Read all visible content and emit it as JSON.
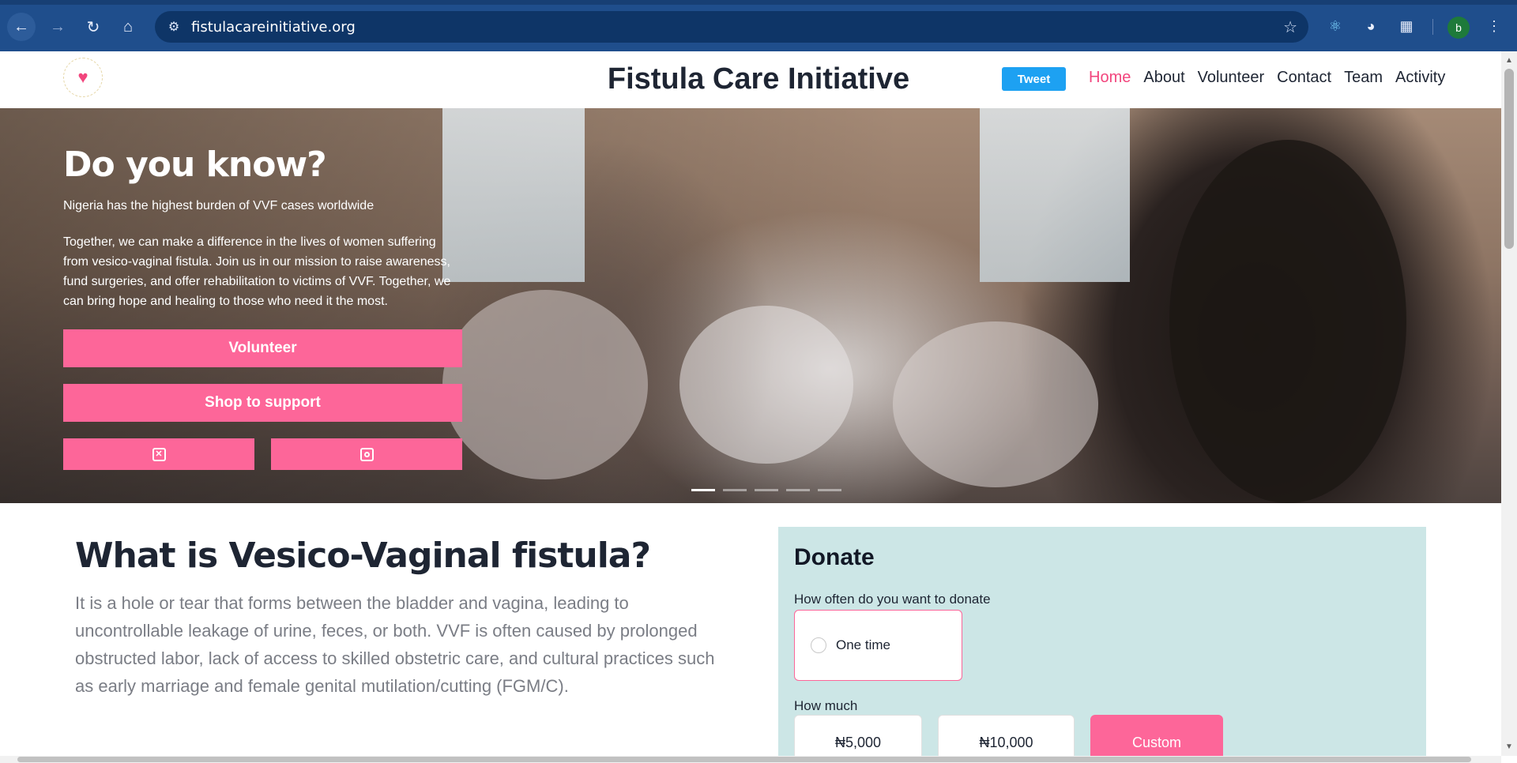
{
  "browser": {
    "url": "fistulacareinitiative.org",
    "profile_initial": "b"
  },
  "header": {
    "title": "Fistula Care Initiative",
    "tweet_label": "Tweet",
    "nav": [
      {
        "label": "Home",
        "active": true
      },
      {
        "label": "About",
        "active": false
      },
      {
        "label": "Volunteer",
        "active": false
      },
      {
        "label": "Contact",
        "active": false
      },
      {
        "label": "Team",
        "active": false
      },
      {
        "label": "Activity",
        "active": false
      }
    ]
  },
  "hero": {
    "heading": "Do you know?",
    "subtitle": "Nigeria has the highest burden of VVF cases worldwide",
    "paragraph": "Together, we can make a difference in the lives of women suffering from vesico-vaginal fistula. Join us in our mission to raise awareness, fund surgeries, and offer rehabilitation to victims of VVF. Together, we can bring hope and healing to those who need it the most.",
    "volunteer_label": "Volunteer",
    "shop_label": "Shop to support",
    "social": [
      "x-icon",
      "instagram-icon"
    ],
    "slides": 5,
    "active_slide": 1
  },
  "about": {
    "heading": "What is Vesico-Vaginal fistula?",
    "text": "It is a hole or tear that forms between the bladder and vagina, leading to uncontrollable leakage of urine, feces, or both. VVF is often caused by prolonged obstructed labor, lack of access to skilled obstetric care, and cultural practices such as early marriage and female genital mutilation/cutting (FGM/C)."
  },
  "donate": {
    "title": "Donate",
    "frequency_question": "How often do you want to donate",
    "frequency_option": "One time",
    "amount_question": "How much",
    "amounts": [
      "₦5,000",
      "₦10,000",
      "Custom"
    ]
  },
  "colors": {
    "brand_pink": "#fd6699",
    "tweet_blue": "#1da1f2",
    "donate_bg": "#cce6e6",
    "chrome_blue": "#1f4e8c"
  }
}
